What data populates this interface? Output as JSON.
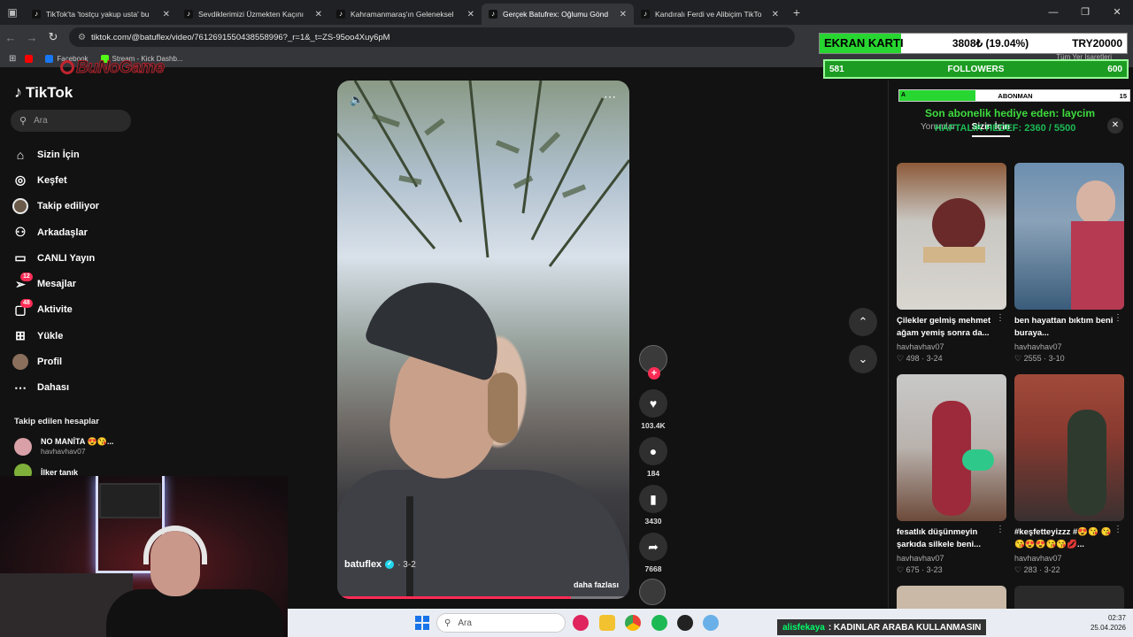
{
  "browser": {
    "tabs": [
      {
        "title": "TikTok'ta 'tostçu yakup usta' bu",
        "active": false
      },
      {
        "title": "Sevdiklerimizi Üzmekten Kaçını",
        "active": false
      },
      {
        "title": "Kahramanmaraş'ın Geleneksel",
        "active": false
      },
      {
        "title": "Gerçek Batufrex: Oğlumu Gönd",
        "active": true
      },
      {
        "title": "Kandıralı Ferdi ve Alibiçim TikTo",
        "active": false
      }
    ],
    "url": "tiktok.com/@batuflex/video/7612691550438558996?_r=1&_t=ZS-95oo4Xuy6pM",
    "bookmarks": [
      "Facebook",
      "Stream - Kick Dashb..."
    ],
    "bookmarks_right": "Tüm Yer İşaretleri"
  },
  "overlay": {
    "logo": "BuNoGame",
    "ekran_label": "EKRAN KARTI",
    "ekran_value": "3808₺ (19.04%)",
    "ekran_target": "TRY20000",
    "follow_left": "581",
    "follow_label": "FOLLOWERS",
    "follow_right": "600",
    "abone_left": "A",
    "abone_label": "ABONMAN",
    "abone_right": "15",
    "sub_gift": "Son abonelik hediye eden: laycim",
    "sub_progress": "HAFTALIK HEDEF: 2360 / 5500",
    "chat_user": "alisfekaya",
    "chat_msg": ": KADINLAR ARABA KULLANMASIN"
  },
  "sidebar": {
    "logo": "TikTok",
    "search_placeholder": "Ara",
    "items": [
      {
        "label": "Sizin İçin",
        "icon": "home-icon"
      },
      {
        "label": "Keşfet",
        "icon": "compass-icon"
      },
      {
        "label": "Takip ediliyor",
        "icon": "avatar"
      },
      {
        "label": "Arkadaşlar",
        "icon": "friends-icon"
      },
      {
        "label": "CANLI Yayın",
        "icon": "live-icon"
      },
      {
        "label": "Mesajlar",
        "icon": "send-icon",
        "badge": "12"
      },
      {
        "label": "Aktivite",
        "icon": "inbox-icon",
        "badge": "48"
      },
      {
        "label": "Yükle",
        "icon": "upload-icon"
      },
      {
        "label": "Profil",
        "icon": "avatar"
      },
      {
        "label": "Dahası",
        "icon": "more-icon"
      }
    ],
    "following_header": "Takip edilen hesaplar",
    "accounts": [
      {
        "name": "NO MANİTA 😍😘...",
        "handle": "havhavhav07"
      },
      {
        "name": "İlker tanık",
        "handle": ""
      }
    ]
  },
  "video": {
    "author": "batuflex",
    "date": "· 3-2",
    "more_label": "daha fazlası",
    "progress_fraction": 0.8,
    "likes": "103.4K",
    "comments": "184",
    "saves": "3430",
    "shares": "7668"
  },
  "panel": {
    "tab_left": "Yorumlar",
    "tab_active": "Sizin İçin",
    "videos": [
      {
        "title": "Çilekler gelmiş mehmet ağam yemiş sonra da...",
        "user": "havhavhav07",
        "likes": "498",
        "date": "3-24"
      },
      {
        "title": "ben hayattan bıktım beni buraya...",
        "user": "havhavhav07",
        "likes": "2555",
        "date": "3-10"
      },
      {
        "title": "fesatlık düşünmeyin şarkıda silkele beni...",
        "user": "havhavhav07",
        "likes": "675",
        "date": "3-23"
      },
      {
        "title": "#keşfetteyizzz #😍😘 😘😘😍😍😘😘💋...",
        "user": "havhavhav07",
        "likes": "283",
        "date": "3-22"
      }
    ]
  },
  "taskbar": {
    "search_placeholder": "Ara",
    "time": "02:37",
    "date": "25.04.2026"
  }
}
